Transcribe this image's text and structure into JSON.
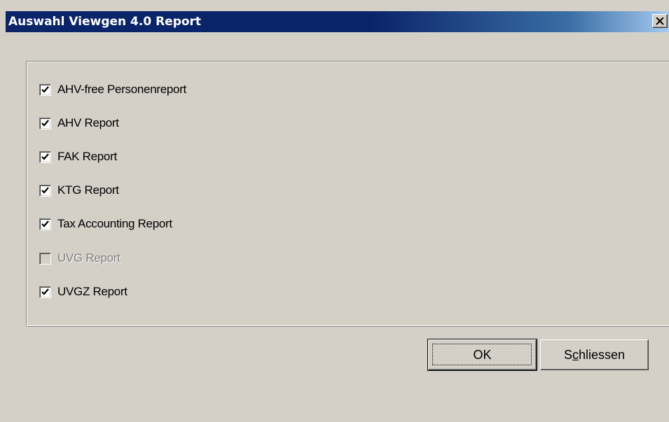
{
  "window": {
    "title": "Auswahl Viewgen 4.0 Report",
    "close_symbol": "×"
  },
  "reports": [
    {
      "label": "AHV-free Personenreport",
      "checked": true,
      "enabled": true
    },
    {
      "label": "AHV Report",
      "checked": true,
      "enabled": true
    },
    {
      "label": "FAK Report",
      "checked": true,
      "enabled": true
    },
    {
      "label": "KTG Report",
      "checked": true,
      "enabled": true
    },
    {
      "label": "Tax Accounting Report",
      "checked": true,
      "enabled": true
    },
    {
      "label": "UVG Report",
      "checked": false,
      "enabled": false
    },
    {
      "label": "UVGZ Report",
      "checked": true,
      "enabled": true
    }
  ],
  "buttons": {
    "ok": "OK",
    "close_prefix": "S",
    "close_underlined": "c",
    "close_suffix": "hliessen"
  }
}
